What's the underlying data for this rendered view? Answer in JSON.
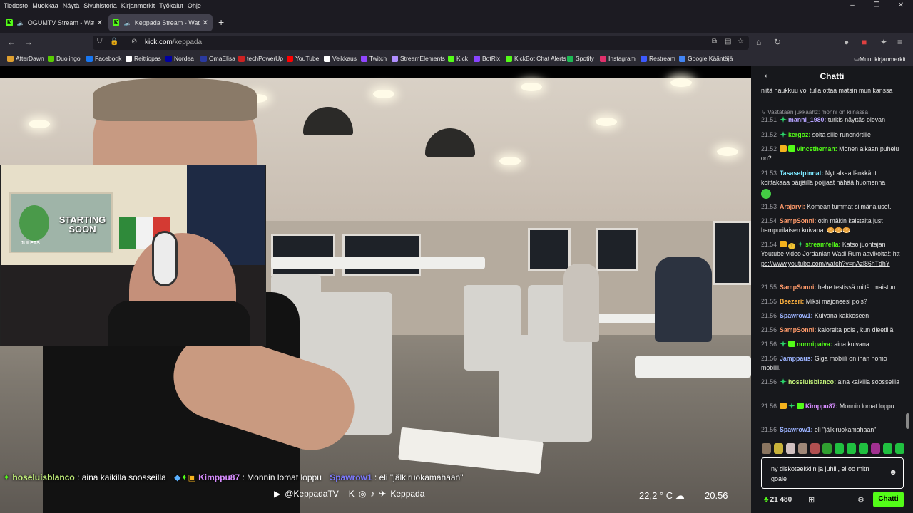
{
  "menu": [
    "Tiedosto",
    "Muokkaa",
    "Näytä",
    "Sivuhistoria",
    "Kirjanmerkit",
    "Työkalut",
    "Ohje"
  ],
  "window_controls": [
    "–",
    "❐",
    "✕"
  ],
  "tabs": [
    {
      "title": "OGUMTV Stream - Watch L",
      "icon": "K"
    },
    {
      "title": "Keppada Stream - Watch Li",
      "icon": "K"
    }
  ],
  "newtab": "+",
  "url": {
    "host": "kick.com",
    "path": "/keppada"
  },
  "bookmarks": [
    {
      "label": "AfterDawn",
      "color": "#e0a030"
    },
    {
      "label": "Duolingo",
      "color": "#58cc02"
    },
    {
      "label": "Facebook",
      "color": "#1877f2"
    },
    {
      "label": "Reittiopas",
      "color": "#ffffff"
    },
    {
      "label": "Nordea",
      "color": "#0000a0"
    },
    {
      "label": "OmaElisa",
      "color": "#2a3aa0"
    },
    {
      "label": "techPowerUp",
      "color": "#cc2222"
    },
    {
      "label": "YouTube",
      "color": "#ff0000"
    },
    {
      "label": "Veikkaus",
      "color": "#ffffff"
    },
    {
      "label": "Twitch",
      "color": "#9146ff"
    },
    {
      "label": "StreamElements",
      "color": "#b08eff"
    },
    {
      "label": "Kick",
      "color": "#53fc18"
    },
    {
      "label": "BotRix",
      "color": "#8844ff"
    },
    {
      "label": "KickBot Chat Alerts",
      "color": "#53fc18"
    },
    {
      "label": "Spotify",
      "color": "#1db954"
    },
    {
      "label": "Instagram",
      "color": "#e1306c"
    },
    {
      "label": "Restream",
      "color": "#3d5afe"
    },
    {
      "label": "Google Kääntäjä",
      "color": "#4285f4"
    }
  ],
  "bookmarks_other": "Muut kirjanmerkit",
  "webcam": {
    "poster_text": "STARTING SOON",
    "poster_small": "JULETS"
  },
  "overlay": {
    "chat": [
      {
        "user": "hoseluisblanco",
        "text": " : aina kaikilla soosseilla"
      },
      {
        "user": "Kimppu87",
        "text": " : Monnin lomat loppu"
      },
      {
        "user": "Spawrow1",
        "text": " : eli \"jälkiruokamahaan\""
      }
    ],
    "social_youtube": "@KeppadaTV",
    "social_name": "Keppada",
    "weather": "22,2 ° C",
    "time": "20.56"
  },
  "chat": {
    "title": "Chatti",
    "messages": [
      {
        "ts": "",
        "user": "",
        "color": "#e4e4e4",
        "badges": [],
        "text": "niitä haukkuu voi tulla ottaa matsin mun kanssa"
      },
      {
        "reply": "↳ Vastataan jukkaahz: monni on kiinassa"
      },
      {
        "ts": "21.51",
        "user": "manni_1980",
        "color": "#b6a3ff",
        "badges": [
          "sub"
        ],
        "text": "turkis näyttäs olevan"
      },
      {
        "ts": "21.52",
        "user": "kergoz",
        "color": "#53fc18",
        "badges": [
          "sub"
        ],
        "text": "soita sille runenörtille"
      },
      {
        "ts": "21.52",
        "user": "vincetheman",
        "color": "#53fc18",
        "badges": [
          "crown",
          "gift"
        ],
        "text": "Monen aikaan puhelu on?"
      },
      {
        "ts": "21.53",
        "user": "Tasasetpinnat",
        "color": "#7de8ff",
        "badges": [],
        "text": "Nyt alkaa länkkärit koittakaaa pärjäillä poijjaat nähää huomenna"
      },
      {
        "ts": "21.53",
        "user": "Arajarvi",
        "color": "#ff9a6a",
        "badges": [],
        "text": "Komean tummat silmänaluset."
      },
      {
        "ts": "21.54",
        "user": "SampSonni",
        "color": "#ff9a6a",
        "badges": [],
        "text": "otin mäkin kaistalta just hampurilaisen kuivana. 🥯🥯🥯"
      },
      {
        "ts": "21.54",
        "user": "streamfella",
        "color": "#53fc18",
        "badges": [
          "crown",
          "num",
          "sub"
        ],
        "text": "Katso juontajan Youtube-video Jordanian Wadi Rum aavikolta!: ",
        "link": "https://www.youtube.com/watch?v=nAzl86hTdhY"
      },
      {
        "ts": "21.55",
        "user": "SampSonni",
        "color": "#ff9a6a",
        "badges": [],
        "text": "hehe testissä miltä. maistuu"
      },
      {
        "ts": "21.55",
        "user": "Beezeri",
        "color": "#ffb23f",
        "badges": [],
        "text": "Miksi majoneesi pois?"
      },
      {
        "ts": "21.56",
        "user": "Spawrow1",
        "color": "#9cb3ff",
        "badges": [],
        "text": "Kuivana kakkoseen"
      },
      {
        "ts": "21.56",
        "user": "SampSonni",
        "color": "#ff9a6a",
        "badges": [],
        "text": "kaloreita pois , kun dieetillä"
      },
      {
        "ts": "21.56",
        "user": "normipaiva",
        "color": "#53fc18",
        "badges": [
          "sub",
          "gift"
        ],
        "text": "aina kuivana"
      },
      {
        "ts": "21.56",
        "user": "Jamppaus",
        "color": "#9cb3ff",
        "badges": [],
        "text": "Giga mobiili on ihan homo mobiili."
      },
      {
        "ts": "21.56",
        "user": "hoseluisblanco",
        "color": "#c3f27a",
        "badges": [
          "sub"
        ],
        "text": "aina kaikilla soosseilla"
      },
      {
        "ts": "21.56",
        "user": "Kimppu87",
        "color": "#d78cff",
        "badges": [
          "crown",
          "sub",
          "gift"
        ],
        "text": "Monnin lomat loppu"
      },
      {
        "ts": "21.56",
        "user": "Spawrow1",
        "color": "#9cb3ff",
        "badges": [],
        "text": "eli \"jälkiruokamahaan\""
      }
    ],
    "input_value": "ny diskoteekkiin ja juhlii, ei oo mitn goale",
    "points": "21 480",
    "send_label": "Chatti"
  },
  "colors": {
    "accent": "#53fc18",
    "chat_bg": "#17181c",
    "browser_bg": "#1c1b22"
  }
}
